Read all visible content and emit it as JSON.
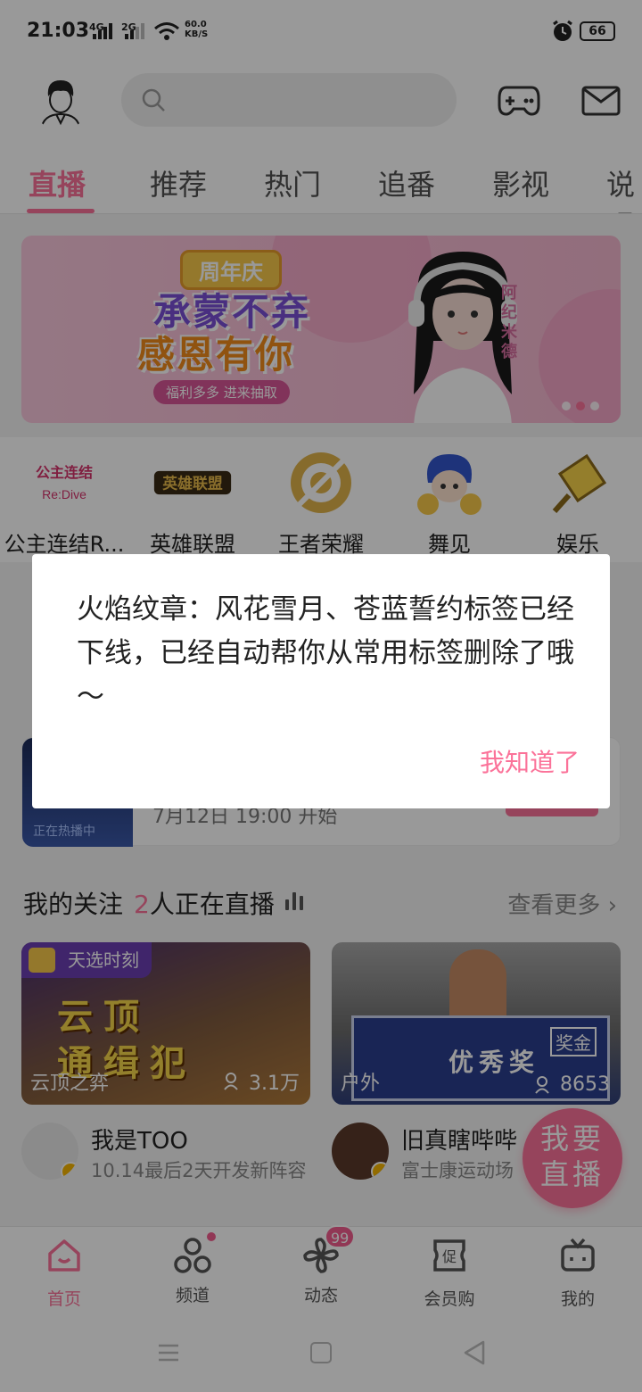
{
  "status_bar": {
    "time": "21:03",
    "signal1": "4G",
    "signal2": "2G",
    "net_speed_value": "60.0",
    "net_speed_unit": "KB/S",
    "battery": "66"
  },
  "header": {
    "avatar": "avatar",
    "search_icon": "search-icon",
    "game_icon": "gamepad-icon",
    "mail_icon": "mail-icon"
  },
  "tabs": [
    {
      "label": "直播",
      "active": true
    },
    {
      "label": "推荐"
    },
    {
      "label": "热门"
    },
    {
      "label": "追番"
    },
    {
      "label": "影视"
    },
    {
      "label": "说唱"
    }
  ],
  "banner": {
    "tag": "周年庆",
    "line1": "承蒙不弃",
    "line2": "感恩有你",
    "button": "福利多多 进来抽取",
    "vertical_text": "阿纪米德",
    "dots": 3,
    "active_dot": 1
  },
  "categories": [
    {
      "label": "公主连结R...",
      "logo": "Re:Dive"
    },
    {
      "label": "英雄联盟",
      "logo": "英雄联盟"
    },
    {
      "label": "王者荣耀"
    },
    {
      "label": "舞见"
    },
    {
      "label": "娱乐"
    }
  ],
  "hidden_card": {
    "thumb_text": "正在热播中",
    "date": "7月12日 19:00 开始"
  },
  "follow": {
    "title": "我的关注",
    "count": "2",
    "live_text": "人正在直播",
    "more": "查看更多"
  },
  "streams": [
    {
      "badge": "天选时刻",
      "cover_text1": "云顶",
      "cover_text2": "通缉犯",
      "category": "云顶之弈",
      "viewers": "3.1万",
      "streamer": "我是TOO",
      "subtitle": "10.14最后2天开发新阵容"
    },
    {
      "category": "户外",
      "viewers": "8653",
      "board_text": "优秀奖",
      "board_badge": "奖金",
      "streamer": "旧真瞎哔哔",
      "subtitle": "富士康运动场"
    }
  ],
  "fab": {
    "line1": "我要",
    "line2": "直播"
  },
  "bottom_nav": [
    {
      "label": "首页",
      "active": true
    },
    {
      "label": "频道",
      "dot": true
    },
    {
      "label": "动态",
      "count": "99"
    },
    {
      "label": "会员购"
    },
    {
      "label": "我的"
    }
  ],
  "dialog": {
    "message": "火焰纹章：风花雪月、苍蓝誓约标签已经下线，已经自动帮你从常用标签删除了哦～",
    "button": "我知道了"
  },
  "colors": {
    "accent": "#fb7299",
    "overlay": "rgba(0,0,0,0.4)"
  }
}
